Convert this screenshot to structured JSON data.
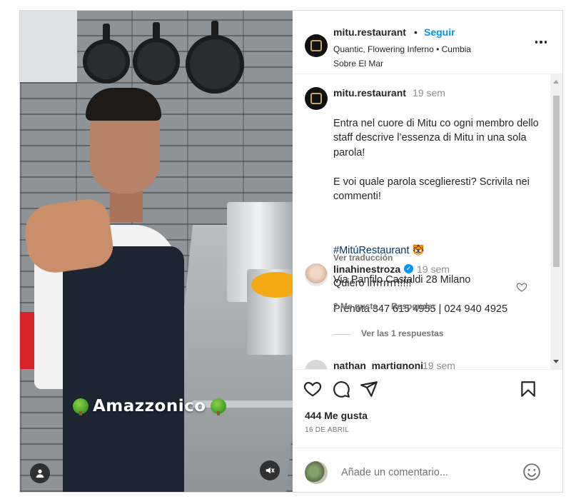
{
  "post": {
    "overlay_text": "Amazzonico",
    "author": {
      "username": "mitu.restaurant",
      "separator": "•",
      "follow_label": "Seguir",
      "audio": "Quantic, Flowering Inferno • Cumbia Sobre El Mar"
    },
    "caption": {
      "username": "mitu.restaurant",
      "time": "19 sem",
      "lines": [
        "Entra nel cuore di Mitu co ogni membro dello staff descrive l’essenza di Mitu in una sola parola!",
        "E voi quale parola sceglieresti? Scrivila nei commenti!"
      ],
      "hashtag": "#MitúRestaurant 🐯",
      "address": "Via Panfilo Castaldi 28 Milano",
      "phone": "Prenota 347 615 4955 | 024 940 4925",
      "translate_label": "Ver traducción"
    },
    "comments": [
      {
        "username": "linahinestroza",
        "verified": "✓",
        "time": "19 sem",
        "text": "Quiero irrrrrrrr!!!!!",
        "likes": "2 Me gusta",
        "reply_label": "Responder",
        "view_replies": "Ver las 1 respuestas"
      },
      {
        "username": "nathan_martignoni",
        "time": "19 sem"
      }
    ],
    "likes": "444 Me gusta",
    "date": "16 DE ABRIL",
    "comment_input": {
      "placeholder": "Añade un comentario..."
    }
  },
  "icons": {
    "more": "more-horizontal-icon",
    "like": "heart-icon",
    "comment": "comment-icon",
    "share": "share-icon",
    "save": "bookmark-icon",
    "emoji": "emoji-icon",
    "tagged": "user-icon",
    "mute": "speaker-muted-icon"
  },
  "colors": {
    "accent": "#0095f6",
    "text": "#262626",
    "secondary": "#737373",
    "hashtag": "#00376b"
  }
}
